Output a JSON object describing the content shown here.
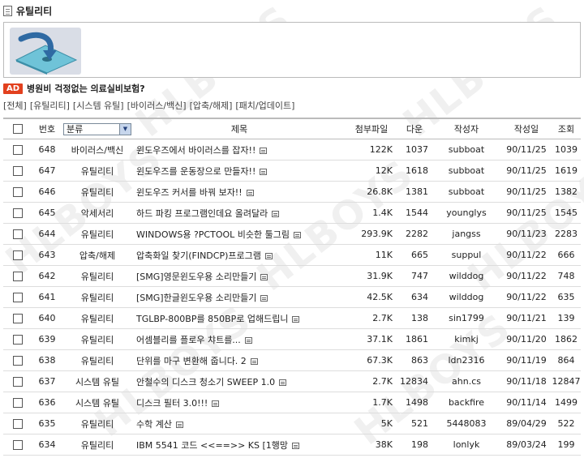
{
  "page": {
    "title": "유틸리티"
  },
  "ad": {
    "badge": "AD",
    "text": "병원비 걱정없는 의료실비보험?"
  },
  "categories": [
    "[전체]",
    "[유틸리티]",
    "[시스템 유틸]",
    "[바이러스/백신]",
    "[압축/해제]",
    "[패치/업데이트]"
  ],
  "table": {
    "headers": {
      "number": "번호",
      "category_select": "분류",
      "title": "제목",
      "file": "첨부파일",
      "downloads": "다운",
      "author": "작성자",
      "date": "작성일",
      "views": "조회"
    },
    "rows": [
      {
        "num": "648",
        "cat": "바이러스/백신",
        "title": "윈도우즈에서 바이러스를 잡자!!",
        "file": "122K",
        "dl": "1037",
        "author": "subboat",
        "date": "90/11/25",
        "views": "1039"
      },
      {
        "num": "647",
        "cat": "유틸리티",
        "title": "윈도우즈를 운동장으로 만들자!!",
        "file": "12K",
        "dl": "1618",
        "author": "subboat",
        "date": "90/11/25",
        "views": "1619"
      },
      {
        "num": "646",
        "cat": "유틸리티",
        "title": "윈도우즈 커서를 바꿔 보자!!",
        "file": "26.8K",
        "dl": "1381",
        "author": "subboat",
        "date": "90/11/25",
        "views": "1382"
      },
      {
        "num": "645",
        "cat": "악세서리",
        "title": "하드 파킹 프로그램인데요 올려달라",
        "file": "1.4K",
        "dl": "1544",
        "author": "younglys",
        "date": "90/11/25",
        "views": "1545"
      },
      {
        "num": "644",
        "cat": "유틸리티",
        "title": "WINDOWS용 ?PCTOOL 비슷한 툴그림",
        "file": "293.9K",
        "dl": "2282",
        "author": "jangss",
        "date": "90/11/23",
        "views": "2283"
      },
      {
        "num": "643",
        "cat": "압축/해제",
        "title": "압축화일 찾기(FINDCP)프로그램",
        "file": "11K",
        "dl": "665",
        "author": "suppul",
        "date": "90/11/22",
        "views": "666"
      },
      {
        "num": "642",
        "cat": "유틸리티",
        "title": "[SMG]영문윈도우용 소리만들기",
        "file": "31.9K",
        "dl": "747",
        "author": "wilddog",
        "date": "90/11/22",
        "views": "748"
      },
      {
        "num": "641",
        "cat": "유틸리티",
        "title": "[SMG]한글윈도우용 소리만들기",
        "file": "42.5K",
        "dl": "634",
        "author": "wilddog",
        "date": "90/11/22",
        "views": "635"
      },
      {
        "num": "640",
        "cat": "유틸리티",
        "title": "TGLBP-800BP를 850BP로 업해드립니",
        "file": "2.7K",
        "dl": "138",
        "author": "sin1799",
        "date": "90/11/21",
        "views": "139"
      },
      {
        "num": "639",
        "cat": "유틸리티",
        "title": "어셈블리를 플로우 챠트를...",
        "file": "37.1K",
        "dl": "1861",
        "author": "kimkj",
        "date": "90/11/20",
        "views": "1862"
      },
      {
        "num": "638",
        "cat": "유틸리티",
        "title": "단위를 마구 변환해 줍니다. 2",
        "file": "67.3K",
        "dl": "863",
        "author": "ldn2316",
        "date": "90/11/19",
        "views": "864"
      },
      {
        "num": "637",
        "cat": "시스템 유틸",
        "title": "안철수의 디스크 청소기 SWEEP 1.0",
        "file": "2.7K",
        "dl": "12834",
        "author": "ahn.cs",
        "date": "90/11/18",
        "views": "12847"
      },
      {
        "num": "636",
        "cat": "시스템 유틸",
        "title": "디스크 필터 3.0!!!",
        "file": "1.7K",
        "dl": "1498",
        "author": "backfire",
        "date": "90/11/14",
        "views": "1499"
      },
      {
        "num": "635",
        "cat": "유틸리티",
        "title": "수학 계산",
        "file": "5K",
        "dl": "521",
        "author": "5448083",
        "date": "89/04/29",
        "views": "522"
      },
      {
        "num": "634",
        "cat": "유틸리티",
        "title": "IBM 5541 코드 <<==>> KS [1행망",
        "file": "38K",
        "dl": "198",
        "author": "lonlyk",
        "date": "89/03/24",
        "views": "199"
      }
    ]
  },
  "watermark": "HLBOYS",
  "colors": {
    "ad_badge": "#e2401e",
    "header_rule": "#bbbbbb"
  },
  "icons": {
    "title": "document-icon",
    "banner": "download-arrow-icon",
    "memo": "memo-icon",
    "select_arrow": "chevron-down-icon"
  }
}
